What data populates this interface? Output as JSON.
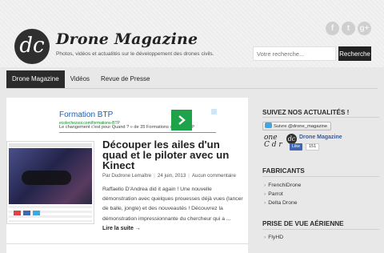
{
  "header": {
    "logo_glyph": "dc",
    "site_title": "Drone Magazine",
    "site_description": "Photos, vidéos et actualités sur le développement des drones civils.",
    "social": [
      {
        "icon": "facebook-icon",
        "glyph": "f"
      },
      {
        "icon": "twitter-icon",
        "glyph": "t"
      },
      {
        "icon": "google-plus-icon",
        "glyph": "g+"
      }
    ],
    "search": {
      "placeholder": "Votre recherche...",
      "button_label": "Recherche"
    }
  },
  "nav": {
    "items": [
      {
        "label": "Drone Magazine",
        "active": true
      },
      {
        "label": "Vidéos",
        "active": false
      },
      {
        "label": "Revue de Presse",
        "active": false
      }
    ]
  },
  "ad": {
    "title": "Formation BTP",
    "url": "ecolechezsoi.com/formations-BTP",
    "text": "Le changement c'est pour Quand ? » de 35 Formations dans le BTP",
    "arrow_color": "#1fa34a"
  },
  "post": {
    "title": "Découper les ailes d'un quad et le piloter avec un Kinect",
    "author": "Par Dudrone Lemaître",
    "date": "24 juin, 2013",
    "comments": "Aucun commentaire",
    "excerpt": "Raffaello D'Andrea did it again ! Une nouvelle démonstration avec quelques prouesses déjà vues (lancer de balle, jongle) et des nouveautés ! Découvrez la démonstration impressionnante du chercheur qui a ...",
    "read_more": "Lire la suite →"
  },
  "sidebar": {
    "follow_title": "SUIVEZ NOS ACTUALITÉS !",
    "twitter_button": "Suivre @drone_magazine",
    "facebook": {
      "logo_text": "one C d r",
      "page_name": "Drone Magazine",
      "like_label": "Like",
      "like_count": "151"
    },
    "fabricants_title": "FABRICANTS",
    "fabricants": [
      "FrenchiDrone",
      "Parrot",
      "Delta Drone"
    ],
    "aerial_title": "PRISE DE VUE AÉRIENNE",
    "aerial": [
      "FlyHD"
    ]
  },
  "colors": {
    "accent_dark": "#2b2b2b",
    "link_blue": "#1a5fb4",
    "facebook_blue": "#4267b2"
  }
}
